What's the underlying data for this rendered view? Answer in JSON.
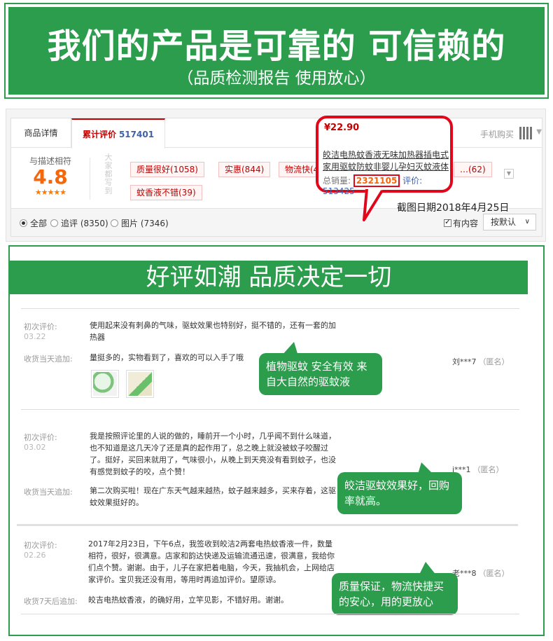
{
  "banner": {
    "title": "我们的产品是可靠的 可信赖的",
    "subtitle": "（品质检测报告 使用放心）"
  },
  "tabs": {
    "detail": "商品详情",
    "review": "累计评价",
    "review_count": "517401",
    "mobile_buy": "手机购买"
  },
  "score": {
    "label": "与描述相符",
    "value": "4.8",
    "stars": "★★★★★"
  },
  "impressions": {
    "label": "大家都写到",
    "tags": [
      "质量很好(1058)",
      "实惠(844)",
      "物流快(474)",
      "…(62)",
      "蚊香液不错(39)"
    ]
  },
  "filter": {
    "all": "全部",
    "followup": "追评 (8350)",
    "pictures": "图片 (7346)",
    "has_content": "有内容",
    "sort": "按默认"
  },
  "callout": {
    "price": "¥22.90",
    "product_name": "皎洁电热蚊香液无味加热器插电式家用驱蚊防蚊非婴儿孕妇灭蚊液体",
    "sales_label": "总销量:",
    "sales_value": "2321105",
    "review_label": "评价:",
    "review_value": "513425"
  },
  "screenshot_date": "截图日期2018年4月25日",
  "reviews_header": "好评如潮 品质决定一切",
  "reviews": [
    {
      "first_label": "初次评价:",
      "first_date": "03.22",
      "first_text": "使用起来没有刺鼻的气味，驱蚊效果也特别好，挺不错的，还有一套的加热器",
      "follow_label": "收货当天追加:",
      "follow_text": "量挺多的，实物看到了，喜欢的可以入手了哦",
      "user": "刘***7",
      "anon": "（匿名）",
      "bubble": "植物驱蚊 安全有效 来自大自然的驱蚊液"
    },
    {
      "first_label": "初次评价:",
      "first_date": "03.02",
      "first_text": "我是按照评论里的人说的做的，睡前开一个小时，几乎闻不到什么味道，也不知道是这几天冷了还是真的起作用了，总之晚上就没被蚊子咬醒过了。挺好，买回来就用了，气味很小，从晚上到天亮没有看到蚊子，也没有感觉到蚊子的咬，点个赞！",
      "follow_label": "收货当天追加:",
      "follow_text": "第二次购买啦！现在广东天气越来越热，蚊子越来越多，买来存着，这驱蚊效果挺好的。",
      "user": "j***1",
      "anon": "（匿名）",
      "bubble": "皎洁驱蚊效果好，回购率就高。"
    },
    {
      "first_label": "初次评价:",
      "first_date": "02.26",
      "first_text": "2017年2月23日，下午6点，我签收到皎洁2两套电热蚊香液一件，数量相符，很好，很满意。店家和韵达快递及运输流通迅速，很满意，我给你们点个赞。谢谢。由于，儿子在家把着电脑，今天，我抽机会，上网给店家评价。宝贝我还没有用，等用时再追加评价。望原谅。",
      "follow_label": "收货7天后追加:",
      "follow_text": "皎吉电热蚊香液，的确好用，立竿见影，不错好用。谢谢。",
      "user": "老***8",
      "anon": "（匿名）",
      "bubble": "质量保证，物流快捷买的安心，用的更放心"
    }
  ],
  "colors": {
    "brand_green": "#2b9d4c",
    "accent_red": "#e1061a",
    "score_orange": "#f5670a",
    "link_blue": "#3f61a8"
  }
}
